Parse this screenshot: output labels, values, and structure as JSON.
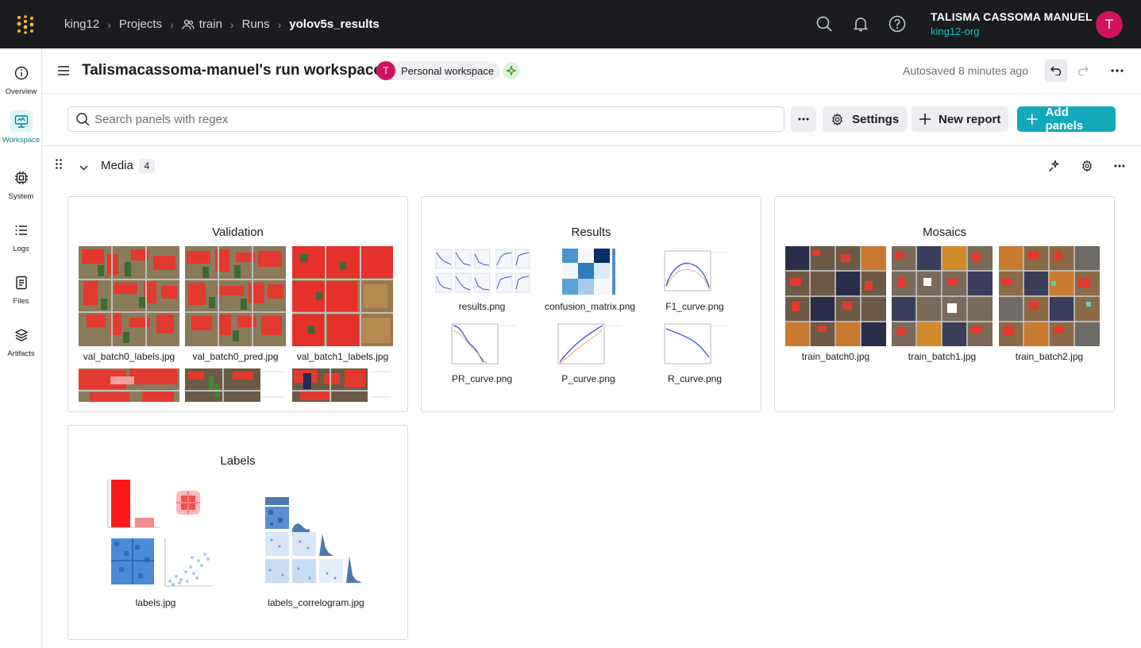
{
  "topbar": {
    "breadcrumbs": [
      "king12",
      "Projects",
      "train",
      "Runs",
      "yolov5s_results"
    ],
    "user_name": "TALISMA CASSOMA MANUEL",
    "user_org": "king12-org",
    "avatar_initial": "T"
  },
  "rail": [
    {
      "label": "Overview",
      "icon": "info-icon"
    },
    {
      "label": "Workspace",
      "icon": "workspace-icon",
      "active": true
    },
    {
      "label": "System",
      "icon": "cpu-icon"
    },
    {
      "label": "Logs",
      "icon": "list-icon"
    },
    {
      "label": "Files",
      "icon": "file-icon"
    },
    {
      "label": "Artifacts",
      "icon": "layers-icon"
    }
  ],
  "header": {
    "title": "Talismacassoma-manuel's run workspace",
    "pill_initial": "T",
    "pill_label": "Personal workspace",
    "autosaved": "Autosaved 8 minutes ago"
  },
  "toolbar": {
    "search_placeholder": "Search panels with regex",
    "settings_label": "Settings",
    "new_report_label": "New report",
    "add_panels_label": "Add panels"
  },
  "section": {
    "title": "Media",
    "count": "4"
  },
  "panels": {
    "validation": {
      "title": "Validation",
      "items": [
        "val_batch0_labels.jpg",
        "val_batch0_pred.jpg",
        "val_batch1_labels.jpg",
        "",
        "",
        ""
      ]
    },
    "results": {
      "title": "Results",
      "items": [
        "results.png",
        "confusion_matrix.png",
        "F1_curve.png",
        "PR_curve.png",
        "P_curve.png",
        "R_curve.png"
      ]
    },
    "mosaics": {
      "title": "Mosaics",
      "items": [
        "train_batch0.jpg",
        "train_batch1.jpg",
        "train_batch2.jpg"
      ]
    },
    "labels": {
      "title": "Labels",
      "items": [
        "labels.jpg",
        "labels_correlogram.jpg"
      ]
    }
  },
  "colors": {
    "topbar_bg": "#1a1c1f",
    "accent": "#13a9ba",
    "avatar": "#d1135e",
    "org_link": "#10bfcc"
  }
}
